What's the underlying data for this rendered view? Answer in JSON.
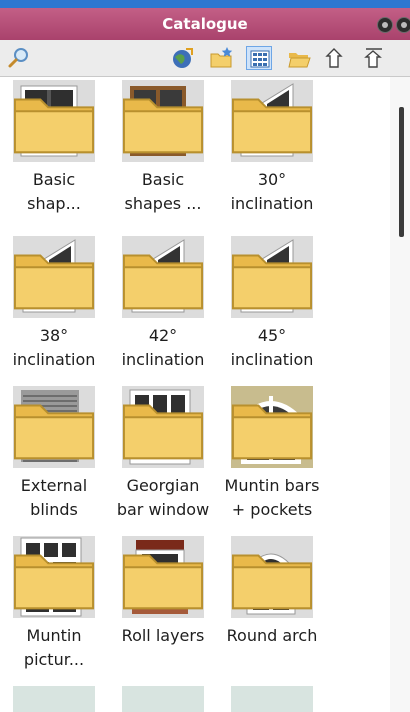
{
  "panel": {
    "title": "Catalogue"
  },
  "toolbar": {
    "icons": [
      "search-icon",
      "globe-icon",
      "folder-star-icon",
      "grid-view-icon",
      "open-folder-icon",
      "up-arrow-icon",
      "up-arrow-icon"
    ]
  },
  "colors": {
    "titlebar": "#b54f78",
    "accent": "#2e77d0",
    "folder": "#f4cf6b"
  },
  "items": [
    {
      "label_line1": "Basic",
      "label_line2": "shap...",
      "thumb": "dark-window"
    },
    {
      "label_line1": "Basic",
      "label_line2": "shapes ...",
      "thumb": "wood-window"
    },
    {
      "label_line1": "30°",
      "label_line2": "inclination",
      "thumb": "incline"
    },
    {
      "label_line1": "38°",
      "label_line2": "inclination",
      "thumb": "incline"
    },
    {
      "label_line1": "42°",
      "label_line2": "inclination",
      "thumb": "incline"
    },
    {
      "label_line1": "45°",
      "label_line2": "inclination",
      "thumb": "incline"
    },
    {
      "label_line1": "External",
      "label_line2": "blinds",
      "thumb": "blinds"
    },
    {
      "label_line1": "Georgian",
      "label_line2": "bar window",
      "thumb": "georgian"
    },
    {
      "label_line1": "Muntin bars",
      "label_line2": "+ pockets",
      "thumb": "muntin-arch"
    },
    {
      "label_line1": "Muntin",
      "label_line2": "pictur...",
      "thumb": "muntin-picture"
    },
    {
      "label_line1": "Roll layers",
      "label_line2": "",
      "thumb": "roll"
    },
    {
      "label_line1": "Round arch",
      "label_line2": "",
      "thumb": "round-arch"
    }
  ]
}
